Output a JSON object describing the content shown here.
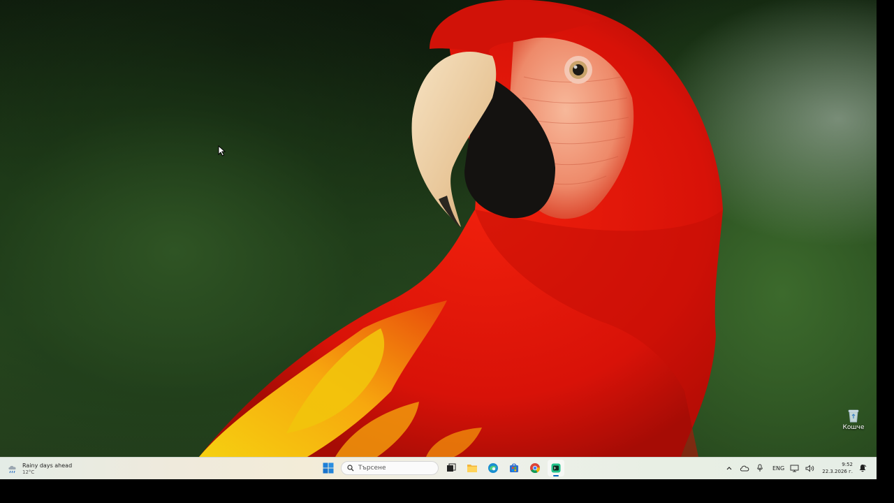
{
  "desktop": {
    "icons": [
      {
        "label": "Кошче",
        "icon": "recycle-bin-icon"
      }
    ]
  },
  "taskbar": {
    "weather": {
      "condition": "Rainy days ahead",
      "temperature": "12°C",
      "icon": "rain-cloud-icon"
    },
    "start_icon": "windows-start-icon",
    "search": {
      "placeholder": "Търсене",
      "icon": "search-icon"
    },
    "pinned": [
      {
        "name": "task-view",
        "icon": "task-view-icon"
      },
      {
        "name": "file-explorer",
        "icon": "folder-icon"
      },
      {
        "name": "edge",
        "icon": "edge-icon"
      },
      {
        "name": "store",
        "icon": "store-icon"
      },
      {
        "name": "chrome",
        "icon": "chrome-icon"
      },
      {
        "name": "terminal-app",
        "icon": "terminal-icon",
        "active": true
      }
    ],
    "tray": {
      "icons": [
        "chevron-up-icon",
        "onedrive-cloud-icon",
        "microphone-icon"
      ],
      "language": "ENG",
      "system_icons": [
        "network-icon",
        "volume-icon"
      ],
      "time": "9:52",
      "date": "22.3.2026 г.",
      "notification_icon": "notification-bell-icon"
    }
  },
  "colors": {
    "taskbar_bg": "#eef0ea",
    "accent": "#0067c0",
    "macaw_red": "#e01508"
  }
}
